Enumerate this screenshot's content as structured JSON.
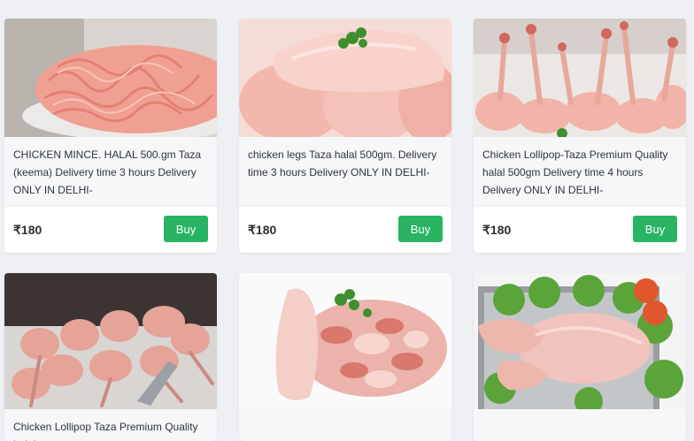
{
  "products": [
    {
      "description": "CHICKEN MINCE. HALAL 500.gm Taza (keema) Delivery time 3 hours Delivery ONLY IN DELHI-",
      "price": "₹180",
      "buy_label": "Buy",
      "image": "chicken-mince-photo"
    },
    {
      "description": "chicken legs Taza halal 500gm. Delivery time 3 hours Delivery ONLY IN DELHI-",
      "price": "₹180",
      "buy_label": "Buy",
      "image": "chicken-legs-photo"
    },
    {
      "description": "Chicken Lollipop-Taza Premium Quality halal 500gm Delivery time 4 hours Delivery ONLY IN DELHI-",
      "price": "₹180",
      "buy_label": "Buy",
      "image": "chicken-lollipop-photo"
    },
    {
      "description": "Chicken Lollipop Taza Premium Quality halal",
      "image": "chicken-lollipop-raw-photo"
    },
    {
      "description": "",
      "image": "chicken-curry-cut-photo"
    },
    {
      "description": "",
      "image": "whole-chicken-photo"
    }
  ],
  "colors": {
    "page_background": "#eef0f4",
    "buy_button": "#28b463",
    "card_background": "#f6f7f9"
  }
}
